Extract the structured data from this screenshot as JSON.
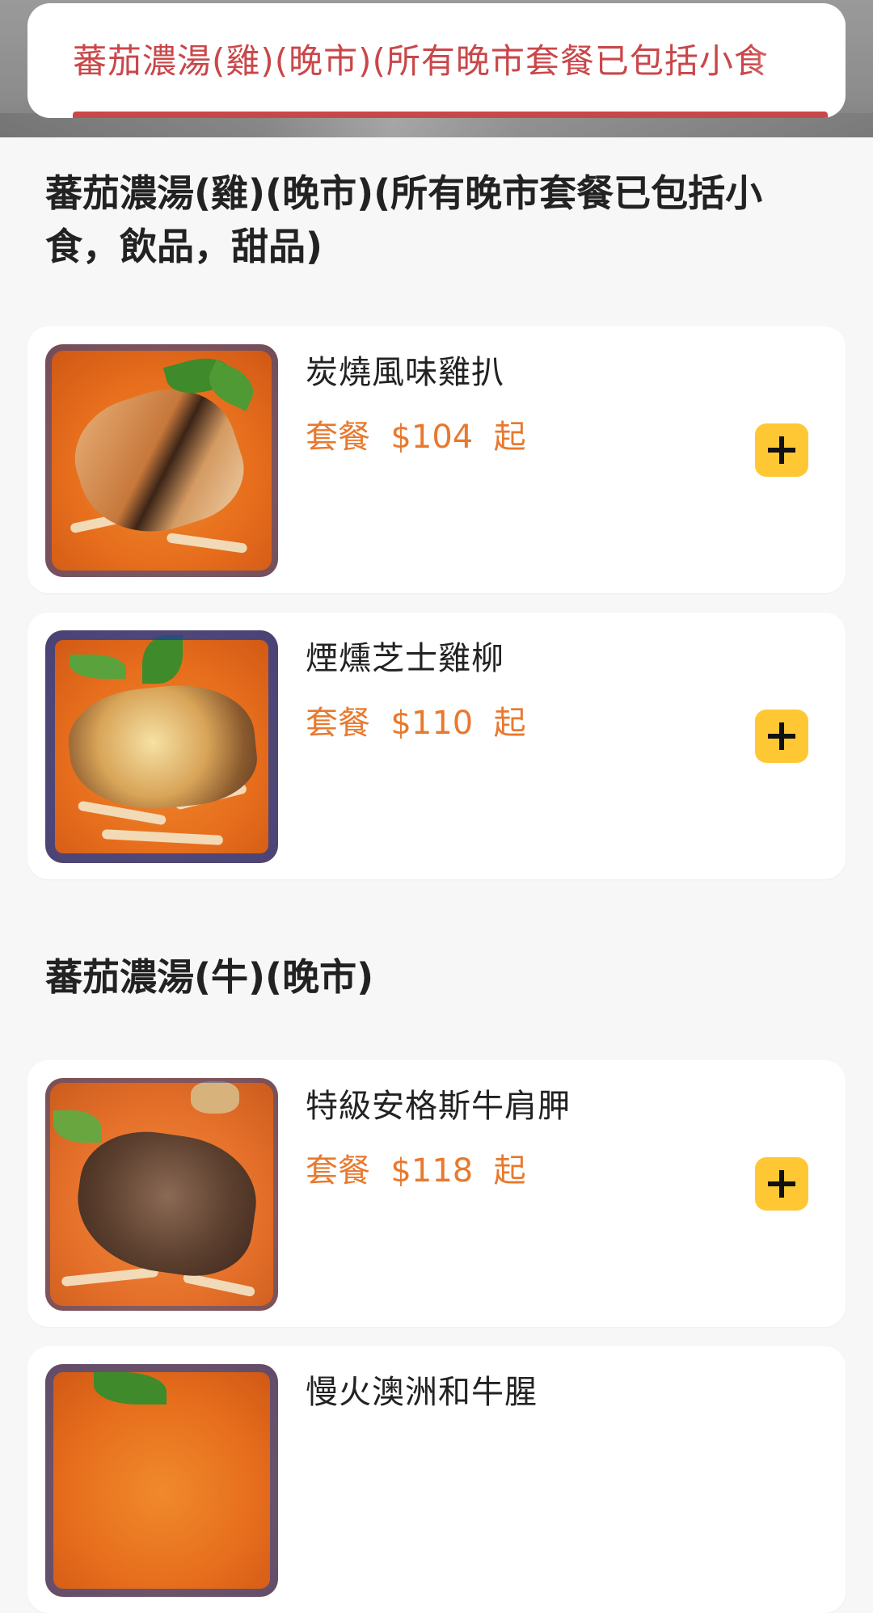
{
  "header": {
    "active_category": "蕃茄濃湯(雞)(晚市)(所有晚市套餐已包括小食"
  },
  "sections": [
    {
      "title": "蕃茄濃湯(雞)(晚市)(所有晚市套餐已包括小食，飲品，甜品)",
      "items": [
        {
          "name": "炭燒風味雞扒",
          "price": "套餐  $104  起",
          "image_icon": "grilled-chicken-soup-image"
        },
        {
          "name": "煙燻芝士雞柳",
          "price": "套餐  $110  起",
          "image_icon": "cheese-chicken-soup-image"
        }
      ]
    },
    {
      "title": "蕃茄濃湯(牛)(晚市)",
      "items": [
        {
          "name": "特級安格斯牛肩胛",
          "price": "套餐  $118  起",
          "image_icon": "angus-beef-soup-image"
        },
        {
          "name": "慢火澳洲和牛腥",
          "price": "",
          "image_icon": "wagyu-beef-soup-image"
        }
      ]
    }
  ],
  "colors": {
    "accent_red": "#c9474a",
    "price_orange": "#e8792e",
    "add_button_yellow": "#ffc733"
  },
  "add_button_icon": "plus-icon"
}
